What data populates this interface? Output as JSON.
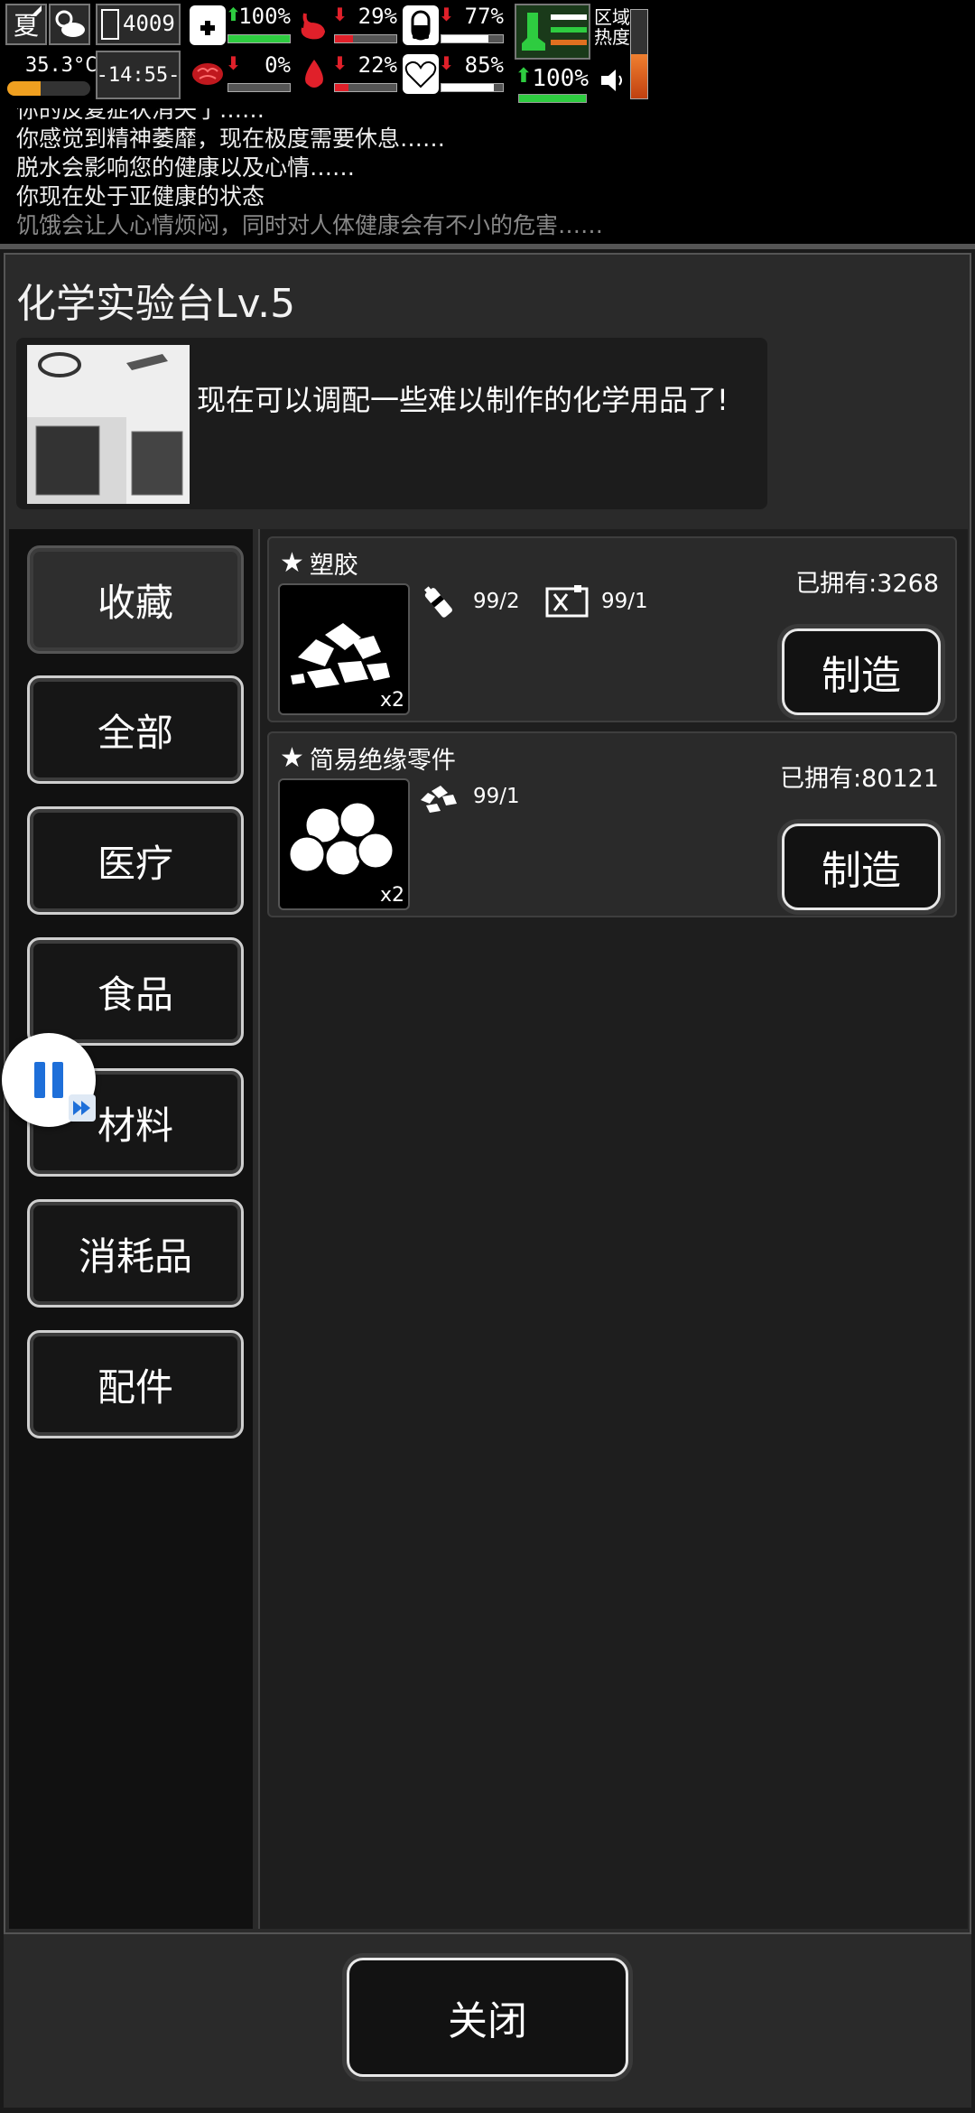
{
  "hud": {
    "season": "夏",
    "weather_icon": "partly-cloudy-icon",
    "temperature": "35.3°C",
    "day": "4009",
    "time": "-14:55-",
    "stats": [
      {
        "icon": "medkit-icon",
        "trend": "up",
        "value": "100%",
        "level": 1.0,
        "color": "#2ecc40"
      },
      {
        "icon": "stomach-icon",
        "trend": "down",
        "value": "29%",
        "level": 0.29,
        "color": "#e0202a"
      },
      {
        "icon": "pill-icon",
        "trend": "down",
        "value": "77%",
        "level": 0.77,
        "color": "#ffffff"
      },
      {
        "icon": "brain-icon",
        "trend": "down",
        "value": "0%",
        "level": 0.0,
        "color": "#e0202a"
      },
      {
        "icon": "water-drop-icon",
        "trend": "down",
        "value": "22%",
        "level": 0.22,
        "color": "#e0202a"
      },
      {
        "icon": "heart-icon",
        "trend": "down",
        "value": "85%",
        "level": 0.85,
        "color": "#ffffff"
      }
    ],
    "stamina": {
      "trend": "up",
      "value": "100%",
      "level": 1.0
    },
    "zone_heat_label": "区域热度",
    "zone_heat_level": 0.5
  },
  "log": [
    "你的反复症状消失了……",
    "你感觉到精神萎靡，现在极度需要休息……",
    "脱水会影响您的健康以及心情……",
    "你现在处于亚健康的状态",
    "饥饿会让人心情烦闷，同时对人体健康会有不小的危害……"
  ],
  "station": {
    "title": "化学实验台Lv.5",
    "description": "现在可以调配一些难以制作的化学用品了!"
  },
  "categories": [
    {
      "label": "收藏",
      "active": true
    },
    {
      "label": "全部",
      "active": false
    },
    {
      "label": "医疗",
      "active": false
    },
    {
      "label": "食品",
      "active": false
    },
    {
      "label": "材料",
      "active": false
    },
    {
      "label": "消耗品",
      "active": false
    },
    {
      "label": "配件",
      "active": false
    }
  ],
  "recipes": [
    {
      "name": "塑胶",
      "owned": "已拥有:3268",
      "quantity": "x2",
      "materials": [
        {
          "icon": "bottle-icon",
          "count": "99/2"
        },
        {
          "icon": "fuel-can-icon",
          "count": "99/1"
        }
      ],
      "button": "制造"
    },
    {
      "name": "简易绝缘零件",
      "owned": "已拥有:80121",
      "quantity": "x2",
      "materials": [
        {
          "icon": "plastic-pile-icon",
          "count": "99/1"
        }
      ],
      "button": "制造"
    }
  ],
  "close_button": "关闭"
}
